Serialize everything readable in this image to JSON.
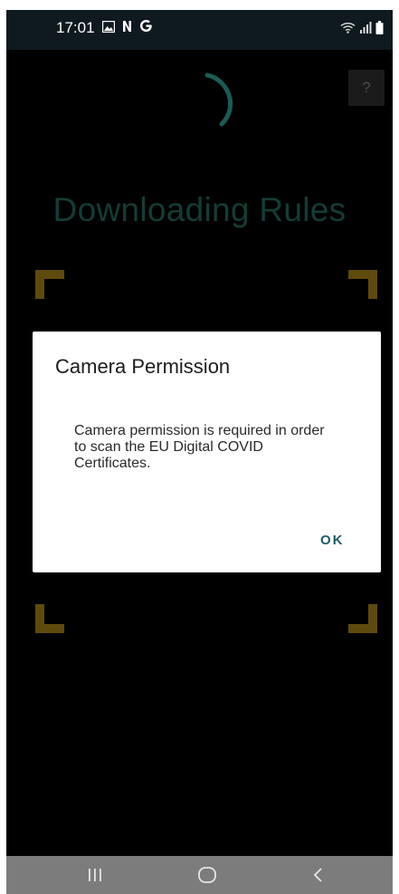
{
  "status_bar": {
    "time": "17:01",
    "notification_icons": [
      "image-icon",
      "n-icon",
      "google-icon"
    ],
    "right_icons": [
      "wifi-icon",
      "signal-icon",
      "battery-icon"
    ]
  },
  "header": {
    "help_label": "?"
  },
  "main": {
    "loading_title": "Downloading Rules"
  },
  "dialog": {
    "title": "Camera Permission",
    "message": "Camera permission is required in order to scan the EU Digital COVID Certificates.",
    "ok_label": "OK"
  },
  "nav_bar": {
    "items": [
      "recent-apps-icon",
      "home-icon",
      "back-icon"
    ]
  },
  "colors": {
    "accent_teal": "#1a5c54",
    "title_teal": "#143c36",
    "scanner_corner": "#5e4a0c",
    "ok_text": "#1f5a66"
  }
}
